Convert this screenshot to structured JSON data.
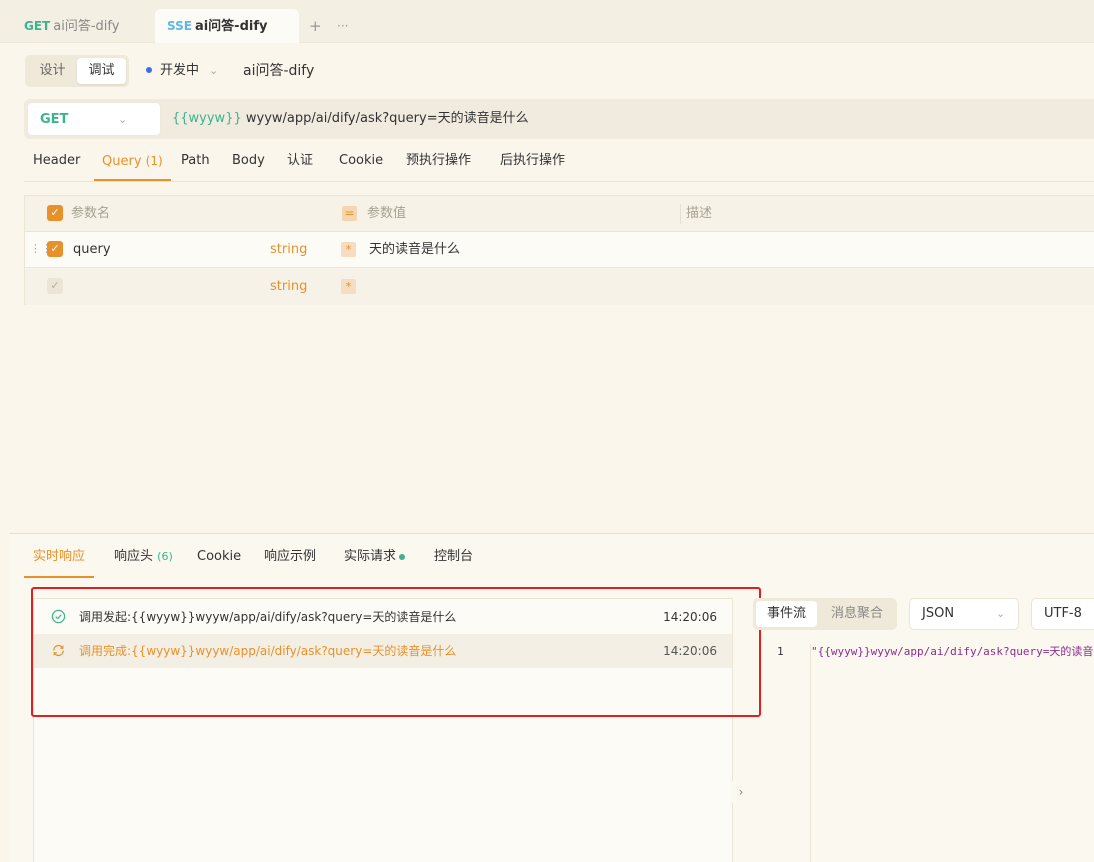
{
  "tabs": [
    {
      "method": "GET",
      "name": "ai问答-dify"
    },
    {
      "method": "SSE",
      "name": "ai问答-dify"
    }
  ],
  "tab_actions": {
    "add": "+",
    "more": "···"
  },
  "mode": {
    "design": "设计",
    "debug": "调试"
  },
  "status": "开发中",
  "api_name": "ai问答-dify",
  "request": {
    "method": "GET",
    "url_var": "{{wyyw}}",
    "url_path": " wyyw/app/ai/dify/ask?query=天的读音是什么"
  },
  "request_tabs": [
    {
      "label": "Header"
    },
    {
      "label": "Query",
      "count": "(1)"
    },
    {
      "label": "Path"
    },
    {
      "label": "Body"
    },
    {
      "label": "认证"
    },
    {
      "label": "Cookie"
    },
    {
      "label": "预执行操作"
    },
    {
      "label": "后执行操作"
    }
  ],
  "params": {
    "headers": {
      "name": "参数名",
      "value": "参数值",
      "desc": "描述"
    },
    "rows": [
      {
        "name": "query",
        "type": "string",
        "required": "*",
        "value": "天的读音是什么"
      },
      {
        "name": "",
        "type": "string",
        "required": "*",
        "value": ""
      }
    ]
  },
  "response_tabs": [
    {
      "label": "实时响应"
    },
    {
      "label": "响应头",
      "count": "(6)"
    },
    {
      "label": "Cookie"
    },
    {
      "label": "响应示例"
    },
    {
      "label": "实际请求"
    },
    {
      "label": "控制台"
    }
  ],
  "events": [
    {
      "text": "调用发起:{{wyyw}}wyyw/app/ai/dify/ask?query=天的读音是什么",
      "time": "14:20:06",
      "icon": "check-circle-icon",
      "color": "#3cb38e"
    },
    {
      "text": "调用完成:{{wyyw}}wyyw/app/ai/dify/ask?query=天的读音是什么",
      "time": "14:20:06",
      "icon": "refresh-icon",
      "color": "#e8912a"
    }
  ],
  "viewer": {
    "event_stream": "事件流",
    "aggregate": "消息聚合",
    "format": "JSON",
    "encoding": "UTF-8",
    "line_number": "1",
    "code": "\"{{wyyw}}wyyw/app/ai/dify/ask?query=天的读音是什么\""
  },
  "colors": {
    "accent": "#e8912a",
    "green": "#3cb38e",
    "highlight": "#e0201f"
  }
}
